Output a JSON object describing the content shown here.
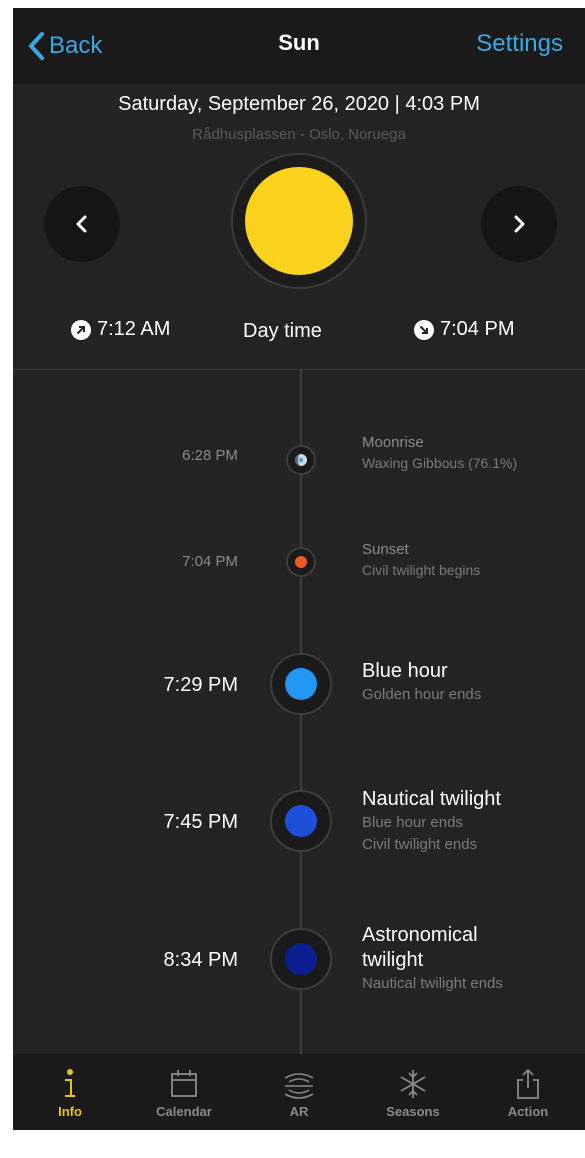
{
  "nav": {
    "back_label": "Back",
    "title": "Sun",
    "settings_label": "Settings"
  },
  "header": {
    "date": "Saturday, September 26, 2020 | 4:03 PM",
    "location": "Rådhusplassen - Oslo, Noruega"
  },
  "summary": {
    "sunrise": "7:12 AM",
    "daytime_label": "Day time",
    "sunset": "7:04 PM"
  },
  "colors": {
    "accent": "#3aa7e6",
    "sun": "#fbd21e",
    "sunset_dot": "#f15a22",
    "blue_hour": "#2196f3",
    "nautical": "#1e4fd8",
    "astronomical": "#0a1f8f",
    "tab_active": "#e7c21b"
  },
  "events": [
    {
      "time": "6:28 PM",
      "title": "Moonrise",
      "subtitle": "Waxing Gibbous (76.1%)",
      "icon": "moon-phase-icon"
    },
    {
      "time": "7:04 PM",
      "title": "Sunset",
      "subtitle": "Civil twilight begins",
      "icon": "sunset-dot"
    },
    {
      "time": "7:29 PM",
      "title": "Blue hour",
      "subtitle": "Golden hour ends",
      "icon": "blue-hour-dot"
    },
    {
      "time": "7:45 PM",
      "title": "Nautical twilight",
      "subtitle": "Blue hour ends",
      "subtitle2": "Civil twilight ends",
      "icon": "nautical-twilight-dot"
    },
    {
      "time": "8:34 PM",
      "title": "Astronomical",
      "title2": "twilight",
      "subtitle": "Nautical twilight ends",
      "icon": "astronomical-twilight-dot"
    }
  ],
  "tabs": [
    {
      "label": "Info",
      "icon": "info-icon",
      "active": true
    },
    {
      "label": "Calendar",
      "icon": "calendar-icon",
      "active": false
    },
    {
      "label": "AR",
      "icon": "ar-icon",
      "active": false
    },
    {
      "label": "Seasons",
      "icon": "snowflake-icon",
      "active": false
    },
    {
      "label": "Action",
      "icon": "share-icon",
      "active": false
    }
  ]
}
